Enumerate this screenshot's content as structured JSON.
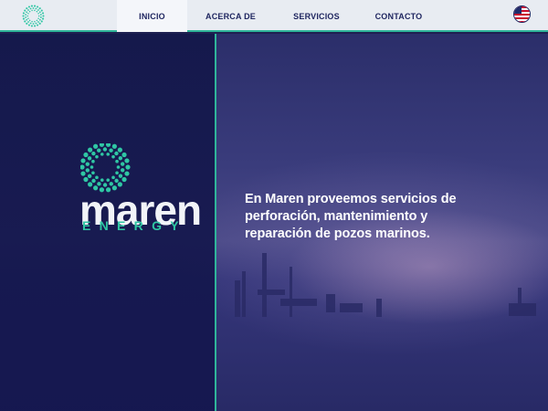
{
  "nav": {
    "items": [
      {
        "label": "INICIO",
        "active": true
      },
      {
        "label": "ACERCA DE",
        "active": false
      },
      {
        "label": "SERVICIOS",
        "active": false
      },
      {
        "label": "CONTACTO",
        "active": false
      }
    ],
    "language_icon": "us-flag-icon"
  },
  "brand": {
    "name": "maren",
    "sub": "ENERGY",
    "accent": "#2fc7a4"
  },
  "hero": {
    "tagline": "En Maren proveemos servicios de perforación, mantenimiento y reparación de pozos marinos."
  },
  "colors": {
    "nav_bg": "#e8ecf2",
    "nav_text": "#1f2660",
    "panel": "#141650",
    "accent": "#2fb59a"
  }
}
